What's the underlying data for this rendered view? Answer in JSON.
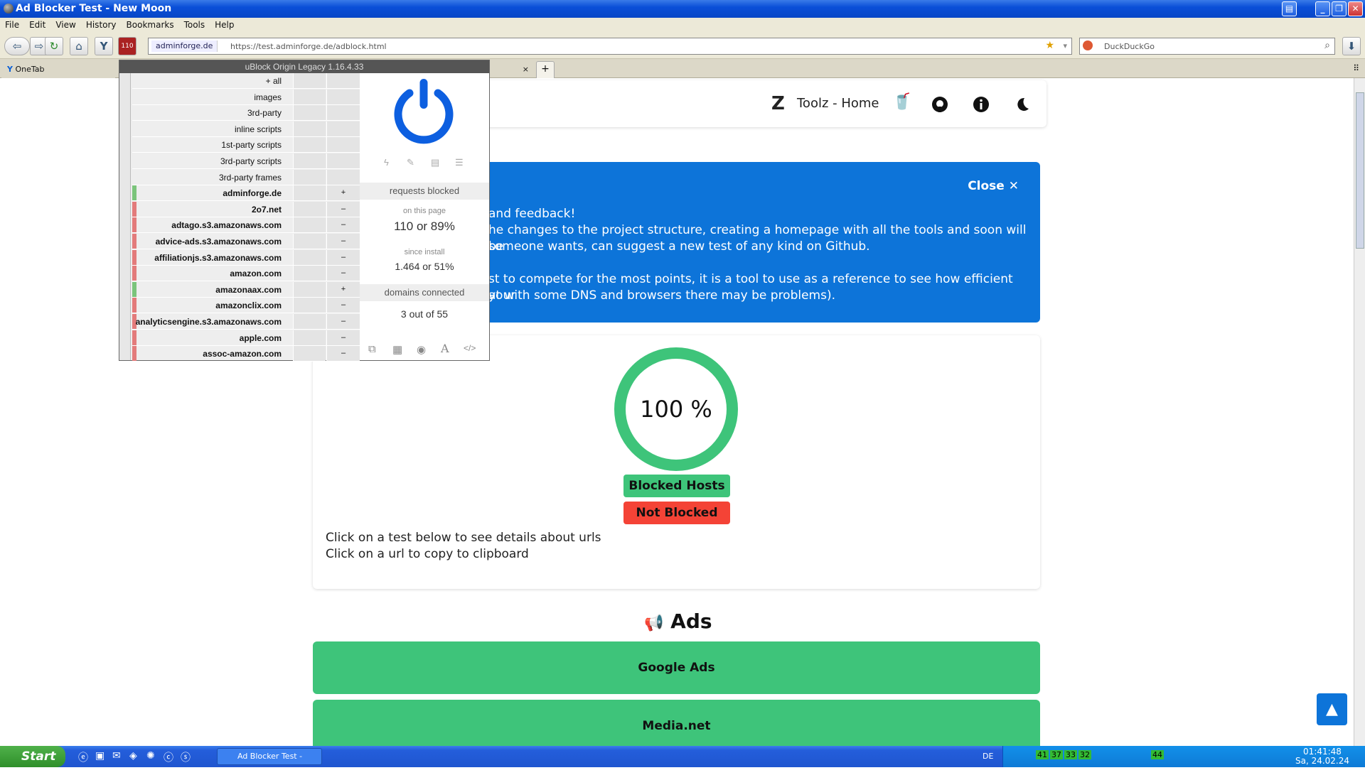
{
  "window": {
    "title": "Ad Blocker Test - New Moon"
  },
  "menu": [
    "File",
    "Edit",
    "View",
    "History",
    "Bookmarks",
    "Tools",
    "Help"
  ],
  "nav": {
    "site_identity": "adminforge.de",
    "url": "https://test.adminforge.de/adblock.html",
    "badge": "110",
    "search_placeholder": "DuckDuckGo"
  },
  "tabs": {
    "onetab": "OneTab",
    "close": "×",
    "new": "+"
  },
  "ubo": {
    "title": "uBlock Origin Legacy 1.16.4.33",
    "rows": [
      {
        "label": "+ all",
        "mark": "",
        "color": ""
      },
      {
        "label": "images",
        "mark": "",
        "color": ""
      },
      {
        "label": "3rd-party",
        "mark": "",
        "color": ""
      },
      {
        "label": "inline scripts",
        "mark": "",
        "color": ""
      },
      {
        "label": "1st-party scripts",
        "mark": "",
        "color": ""
      },
      {
        "label": "3rd-party scripts",
        "mark": "",
        "color": ""
      },
      {
        "label": "3rd-party frames",
        "mark": "",
        "color": ""
      },
      {
        "label": "adminforge.de",
        "mark": "+",
        "color": "#7bc47b"
      },
      {
        "label": "2o7.net",
        "mark": "–",
        "color": "#e37b7b"
      },
      {
        "label": "adtago.s3.amazonaws.com",
        "mark": "–",
        "color": "#e37b7b"
      },
      {
        "label": "advice-ads.s3.amazonaws.com",
        "mark": "–",
        "color": "#e37b7b"
      },
      {
        "label": "affiliationjs.s3.amazonaws.com",
        "mark": "–",
        "color": "#e37b7b"
      },
      {
        "label": "amazon.com",
        "mark": "–",
        "color": "#e37b7b"
      },
      {
        "label": "amazonaax.com",
        "mark": "+",
        "color": "#7bc47b"
      },
      {
        "label": "amazonclix.com",
        "mark": "–",
        "color": "#e37b7b"
      },
      {
        "label": "analyticsengine.s3.amazonaws.com",
        "mark": "–",
        "color": "#e37b7b"
      },
      {
        "label": "apple.com",
        "mark": "–",
        "color": "#e37b7b"
      },
      {
        "label": "assoc-amazon.com",
        "mark": "–",
        "color": "#e37b7b"
      }
    ],
    "requests_blocked": "requests blocked",
    "on_this_page": "on this page",
    "page_count": "110 or 89%",
    "since_install": "since install",
    "install_count": "1.464 or 51%",
    "domains_connected": "domains connected",
    "domains_count": "3 out of 55",
    "power_color": "#0d5fe0"
  },
  "site": {
    "brand": "Toolz - Home",
    "banner": {
      "close": "Close",
      "lines": [
        "and feedback!",
        "he changes to the project structure, creating a homepage with all the tools and soon will be",
        "someone wants, can suggest a new test of any kind on Github.",
        "",
        "st to compete for the most points, it is a tool to use as a reference to see how efficient your",
        "at with some DNS and browsers there may be problems)."
      ]
    },
    "score": "100 %",
    "blocked_label": "Blocked Hosts",
    "not_blocked_label": "Not Blocked",
    "info1": "Click on a test below to see details about urls",
    "info2": "Click on a url to copy to clipboard",
    "section_title": "Ads",
    "tests": [
      "Google Ads",
      "Media.net"
    ],
    "green": "#3ec47a",
    "red": "#f44336",
    "blue": "#0d74d9"
  },
  "taskbar": {
    "start": "Start",
    "task": "Ad Blocker Test - Ne...",
    "lang": "DE",
    "time": "01:41:48",
    "date": "Sa, 24.02.24",
    "tray_nums": [
      "41",
      "37",
      "33",
      "32",
      "44"
    ]
  }
}
